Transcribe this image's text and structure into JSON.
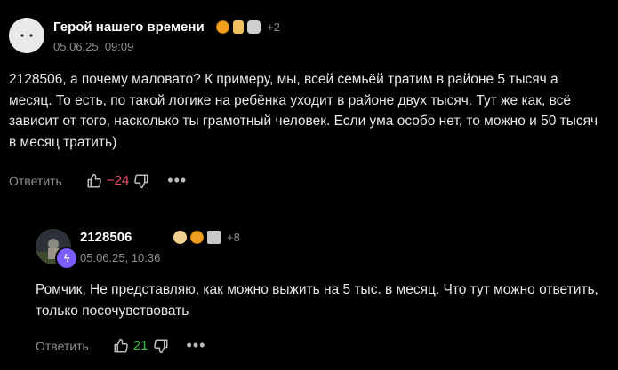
{
  "comments": [
    {
      "author": "Герой нашего времени",
      "awards": [
        "medal-icon",
        "drink-icon",
        "cat-icon"
      ],
      "more_awards": "+2",
      "date": "05.06.25, 09:09",
      "text": "2128506, а почему маловато? К примеру, мы, всей семьёй тратим в районе 5 тысяч а месяц. То есть, по такой логике на ребёнка уходит в районе двух тысяч. Тут же как, всё зависит от того, насколько ты грамотный человек. Если ума особо нет, то можно и 50 тысяч в месяц тратить)",
      "reply_label": "Ответить",
      "score": "−24"
    },
    {
      "author": "2128506",
      "awards": [
        "ribbon-icon",
        "medal-icon",
        "pack-icon"
      ],
      "more_awards": "+8",
      "date": "05.06.25, 10:36",
      "text": "Ромчик, Не представляю, как можно выжить на 5 тыс. в месяц. Что тут можно ответить, только посочувствовать",
      "reply_label": "Ответить",
      "score": "21"
    }
  ],
  "colors": {
    "background": "#000000",
    "negative_score": "#f0506e",
    "positive_score": "#3fc24d",
    "badge": "#7c5cff"
  }
}
